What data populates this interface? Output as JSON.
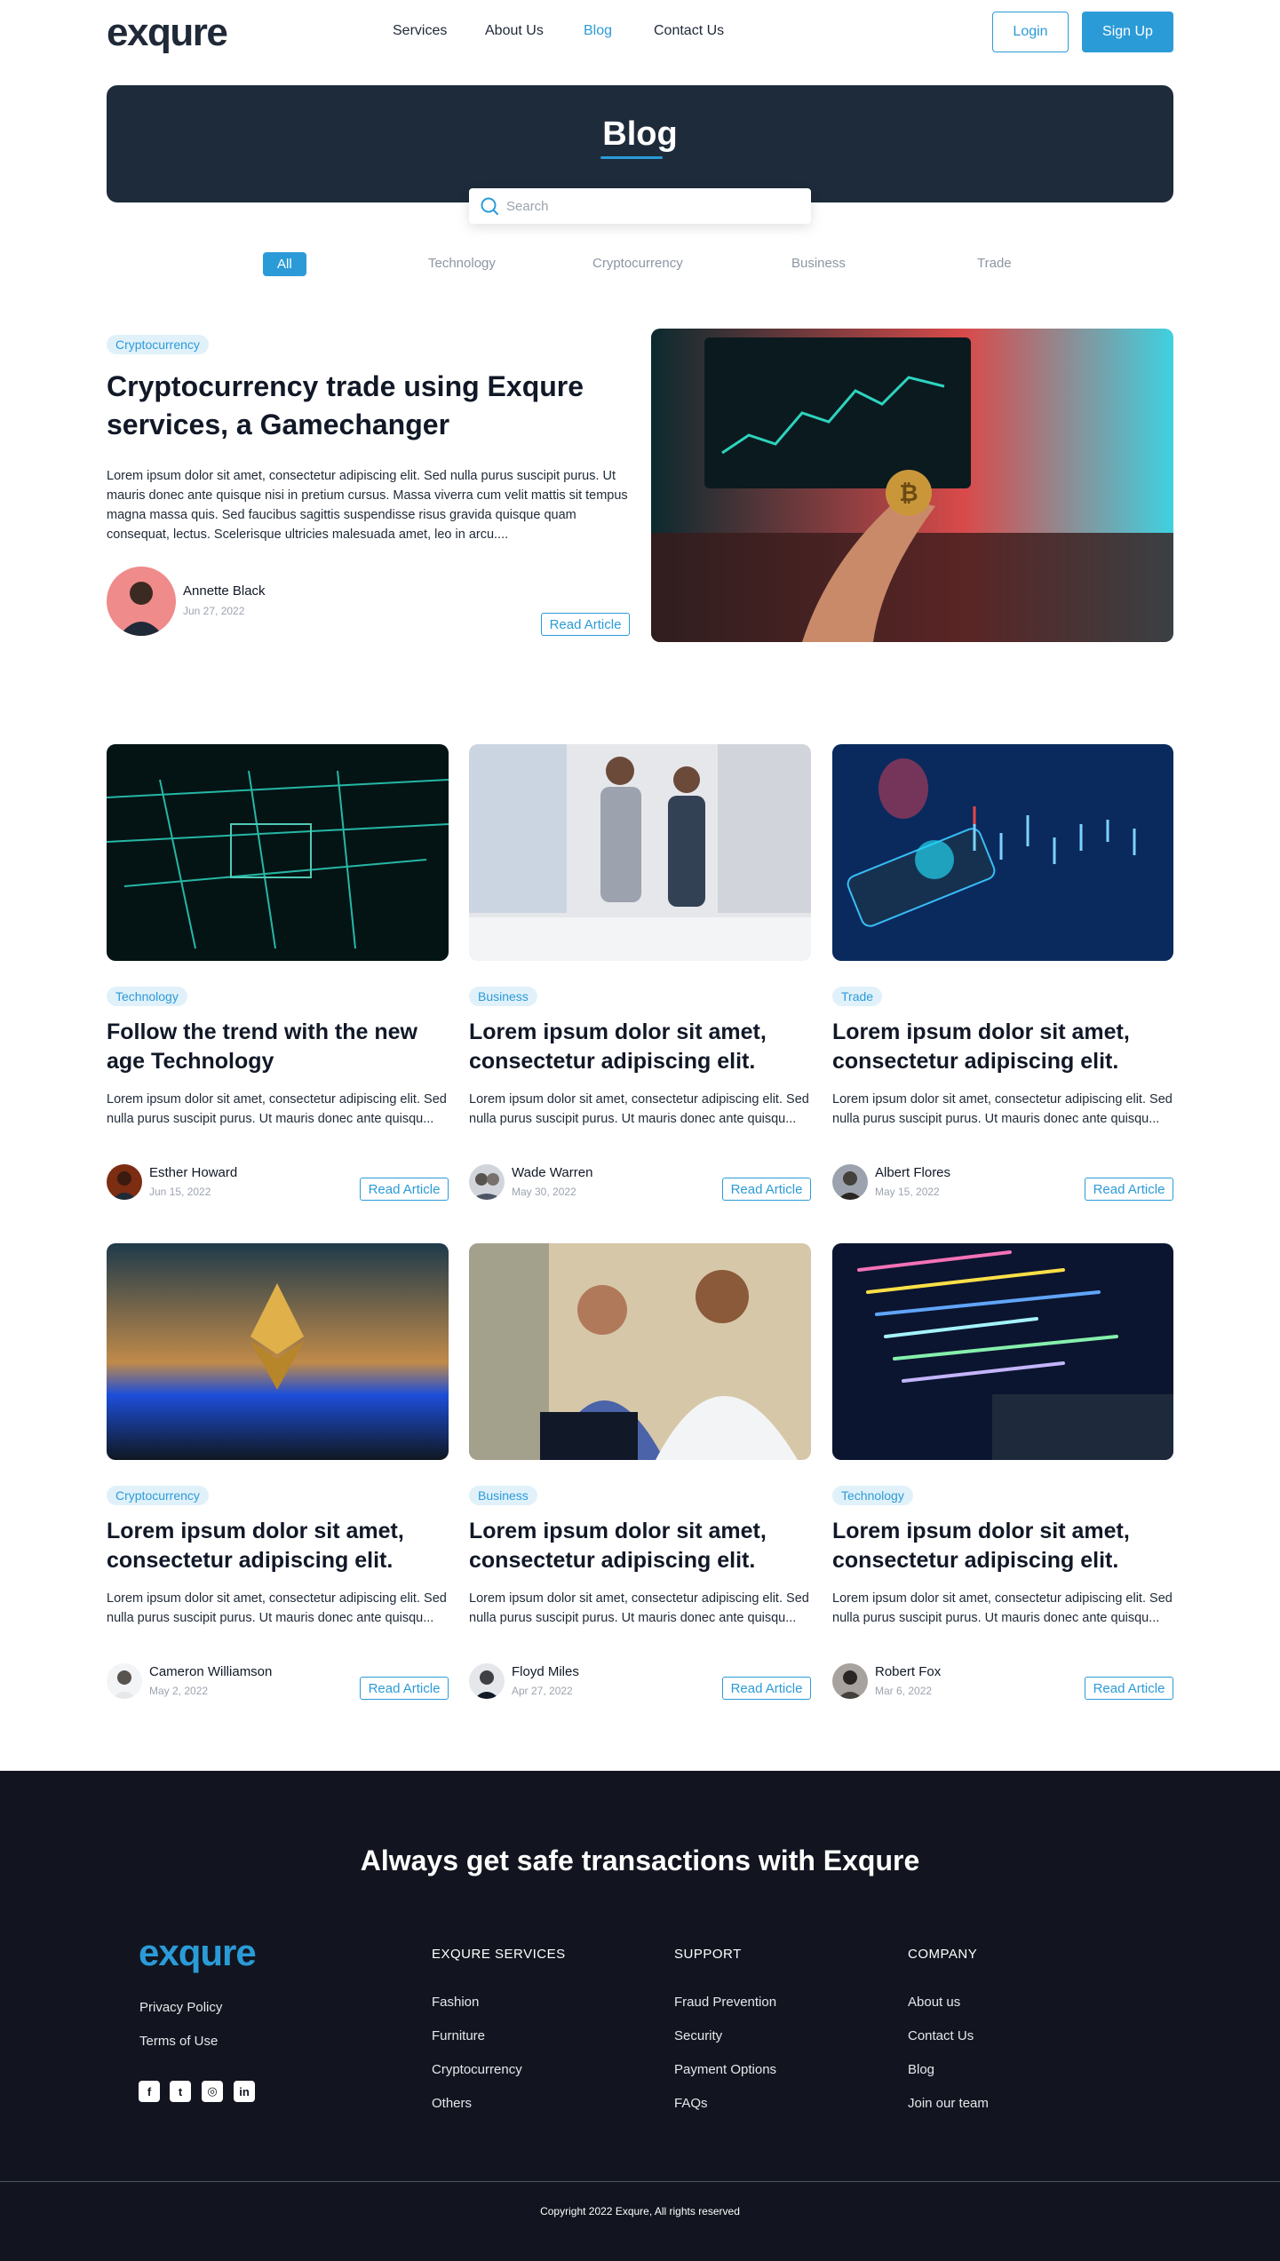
{
  "header": {
    "logo": "exqure",
    "nav": [
      "Services",
      "About Us",
      "Blog",
      "Contact Us"
    ],
    "active_nav": "Blog",
    "login": "Login",
    "signup": "Sign Up"
  },
  "banner": {
    "title": "Blog",
    "search_placeholder": "Search"
  },
  "filters": [
    "All",
    "Technology",
    "Cryptocurrency",
    "Business",
    "Trade"
  ],
  "featured": {
    "tag": "Cryptocurrency",
    "title": "Cryptocurrency trade using Exqure services, a Gamechanger",
    "excerpt": "Lorem ipsum dolor sit amet, consectetur adipiscing elit. Sed nulla purus suscipit purus. Ut mauris donec ante quisque nisi in pretium cursus. Massa viverra cum velit mattis sit tempus magna massa quis. Sed faucibus sagittis suspendisse risus gravida quisque quam consequat, lectus. Scelerisque ultricies malesuada amet, leo in arcu....",
    "author": "Annette Black",
    "date": "Jun 27, 2022",
    "cta": "Read Article"
  },
  "posts": [
    {
      "tag": "Technology",
      "title": "Follow the trend with the new age Technology",
      "excerpt": "Lorem ipsum dolor sit amet, consectetur adipiscing elit. Sed nulla purus suscipit purus. Ut mauris donec ante quisqu...",
      "author": "Esther Howard",
      "date": "Jun 15, 2022",
      "cta": "Read Article"
    },
    {
      "tag": "Business",
      "title": "Lorem ipsum dolor sit amet, consectetur adipiscing elit.",
      "excerpt": "Lorem ipsum dolor sit amet, consectetur adipiscing elit. Sed nulla purus suscipit purus. Ut mauris donec ante quisqu...",
      "author": "Wade Warren",
      "date": "May 30, 2022",
      "cta": "Read Article"
    },
    {
      "tag": "Trade",
      "title": "Lorem ipsum dolor sit amet, consectetur adipiscing elit.",
      "excerpt": "Lorem ipsum dolor sit amet, consectetur adipiscing elit. Sed nulla purus suscipit purus. Ut mauris donec ante quisqu...",
      "author": "Albert Flores",
      "date": "May 15, 2022",
      "cta": "Read Article"
    },
    {
      "tag": "Cryptocurrency",
      "title": "Lorem ipsum dolor sit amet, consectetur adipiscing elit.",
      "excerpt": "Lorem ipsum dolor sit amet, consectetur adipiscing elit. Sed nulla purus suscipit purus. Ut mauris donec ante quisqu...",
      "author": "Cameron Williamson",
      "date": "May 2, 2022",
      "cta": "Read Article"
    },
    {
      "tag": "Business",
      "title": "Lorem ipsum dolor sit amet, consectetur adipiscing elit.",
      "excerpt": "Lorem ipsum dolor sit amet, consectetur adipiscing elit. Sed nulla purus suscipit purus. Ut mauris donec ante quisqu...",
      "author": "Floyd Miles",
      "date": "Apr 27, 2022",
      "cta": "Read Article"
    },
    {
      "tag": "Technology",
      "title": "Lorem ipsum dolor sit amet, consectetur adipiscing elit.",
      "excerpt": "Lorem ipsum dolor sit amet, consectetur adipiscing elit. Sed nulla purus suscipit purus. Ut mauris donec ante quisqu...",
      "author": "Robert Fox",
      "date": "Mar 6, 2022",
      "cta": "Read Article"
    }
  ],
  "footer": {
    "tagline": "Always get safe transactions with Exqure",
    "logo": "exqure",
    "legal_links": [
      "Privacy Policy",
      "Terms of Use"
    ],
    "social_icons": [
      "facebook-icon",
      "twitter-icon",
      "instagram-icon",
      "linkedin-icon"
    ],
    "columns": [
      {
        "heading": "EXQURE SERVICES",
        "links": [
          "Fashion",
          "Furniture",
          "Cryptocurrency",
          "Others"
        ]
      },
      {
        "heading": "SUPPORT",
        "links": [
          "Fraud Prevention",
          "Security",
          "Payment Options",
          "FAQs"
        ]
      },
      {
        "heading": "COMPANY",
        "links": [
          "About us",
          "Contact Us",
          "Blog",
          "Join our team"
        ]
      }
    ],
    "copyright": "Copyright  2022 Exqure, All rights reserved"
  },
  "colors": {
    "accent": "#2b9bd8",
    "banner": "#1e2b3b",
    "footer": "#12151f",
    "tag_bg": "#e1f1fa"
  }
}
